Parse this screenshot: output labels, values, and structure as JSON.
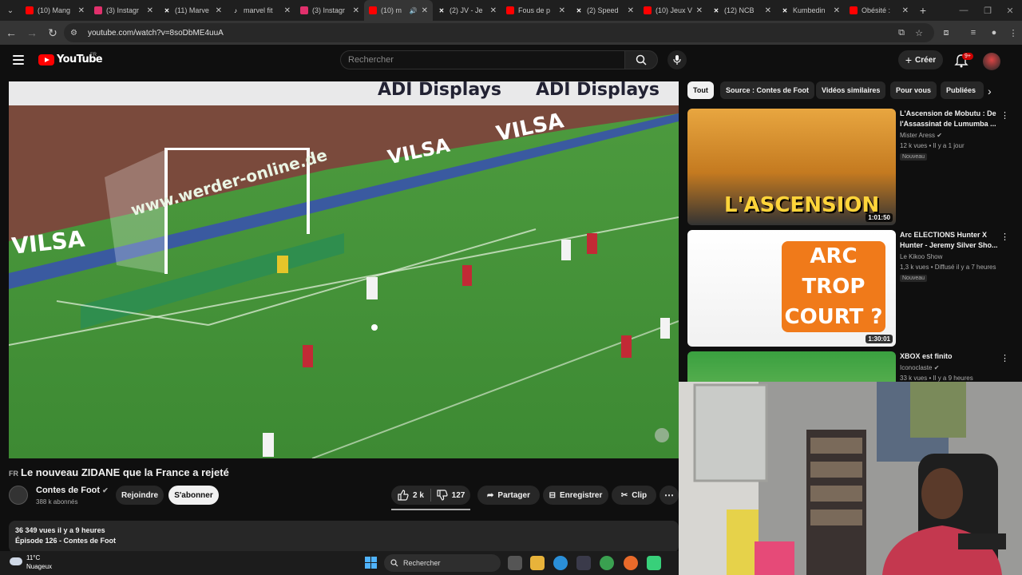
{
  "browser": {
    "tabs": [
      {
        "label": "(10) Mang",
        "favicon": "youtube",
        "color": "#ff0000"
      },
      {
        "label": "(3) Instagr",
        "favicon": "instagram",
        "color": "#e1306c"
      },
      {
        "label": "(11) Marve",
        "favicon": "x",
        "color": "#ffffff"
      },
      {
        "label": "marvel fit",
        "favicon": "tiktok",
        "color": "#ffffff"
      },
      {
        "label": "(3) Instagr",
        "favicon": "instagram",
        "color": "#e1306c"
      },
      {
        "label": "(10) m",
        "favicon": "youtube",
        "color": "#ff0000",
        "active": true
      },
      {
        "label": "(2) JV - Je",
        "favicon": "x",
        "color": "#ffffff"
      },
      {
        "label": "Fous de p",
        "favicon": "youtube",
        "color": "#ff0000"
      },
      {
        "label": "(2) Speed",
        "favicon": "x",
        "color": "#ffffff"
      },
      {
        "label": "(10) Jeux V",
        "favicon": "youtube",
        "color": "#ff0000"
      },
      {
        "label": "(12) NCB",
        "favicon": "x",
        "color": "#ffffff"
      },
      {
        "label": "Kumbedin",
        "favicon": "x",
        "color": "#ffffff"
      },
      {
        "label": "Obésité : ",
        "favicon": "youtube",
        "color": "#ff0000"
      }
    ],
    "url": "youtube.com/watch?v=8soDbME4uuA"
  },
  "header": {
    "logo_text": "YouTube",
    "country": "FR",
    "search_placeholder": "Rechercher",
    "create_label": "Créer",
    "notif_count": "9+"
  },
  "video": {
    "lang": "FR",
    "title": "Le nouveau ZIDANE que la France a rejeté",
    "channel": "Contes de Foot",
    "subscribers": "388 k abonnés",
    "join_label": "Rejoindre",
    "subscribe_label": "S'abonner",
    "likes": "2 k",
    "dislikes": "127",
    "share_label": "Partager",
    "save_label": "Enregistrer",
    "clip_label": "Clip",
    "views_line": "36 349 vues  il y a 9 heures",
    "episode_line": "Épisode 126 - Contes de Foot",
    "scene_banners": [
      "ADI Displays",
      "ADI Displays",
      "VILSA",
      "VILSA",
      "www.werder-online.de",
      "VILSA"
    ]
  },
  "sidebar": {
    "chips": [
      "Tout",
      "Source : Contes de Foot",
      "Vidéos similaires",
      "Pour vous",
      "Publiées"
    ],
    "recommendations": [
      {
        "title": "L'Ascension de Mobutu : De l'Assassinat de Lumumba ...",
        "channel": "Mister Aress",
        "meta": "12 k vues • Il y a 1 jour",
        "badge": "Nouveau",
        "duration": "1:01:50",
        "thumb_text": "L'ASCENSION"
      },
      {
        "title": "Arc ELECTIONS Hunter X Hunter - Jeremy Silver Sho...",
        "channel": "Le Kikoo Show",
        "meta": "1,3 k vues • Diffusé il y a 7 heures",
        "badge": "Nouveau",
        "duration": "1:30:01",
        "thumb_text": "ARC TROP COURT ?"
      },
      {
        "title": "XBOX est finito",
        "channel": "Iconoclaste",
        "meta": "33 k vues • Il y a 9 heures",
        "badge": "",
        "duration": "",
        "thumb_text": ""
      }
    ]
  },
  "taskbar": {
    "temperature": "11°C",
    "condition": "Nuageux",
    "search_label": "Rechercher"
  }
}
